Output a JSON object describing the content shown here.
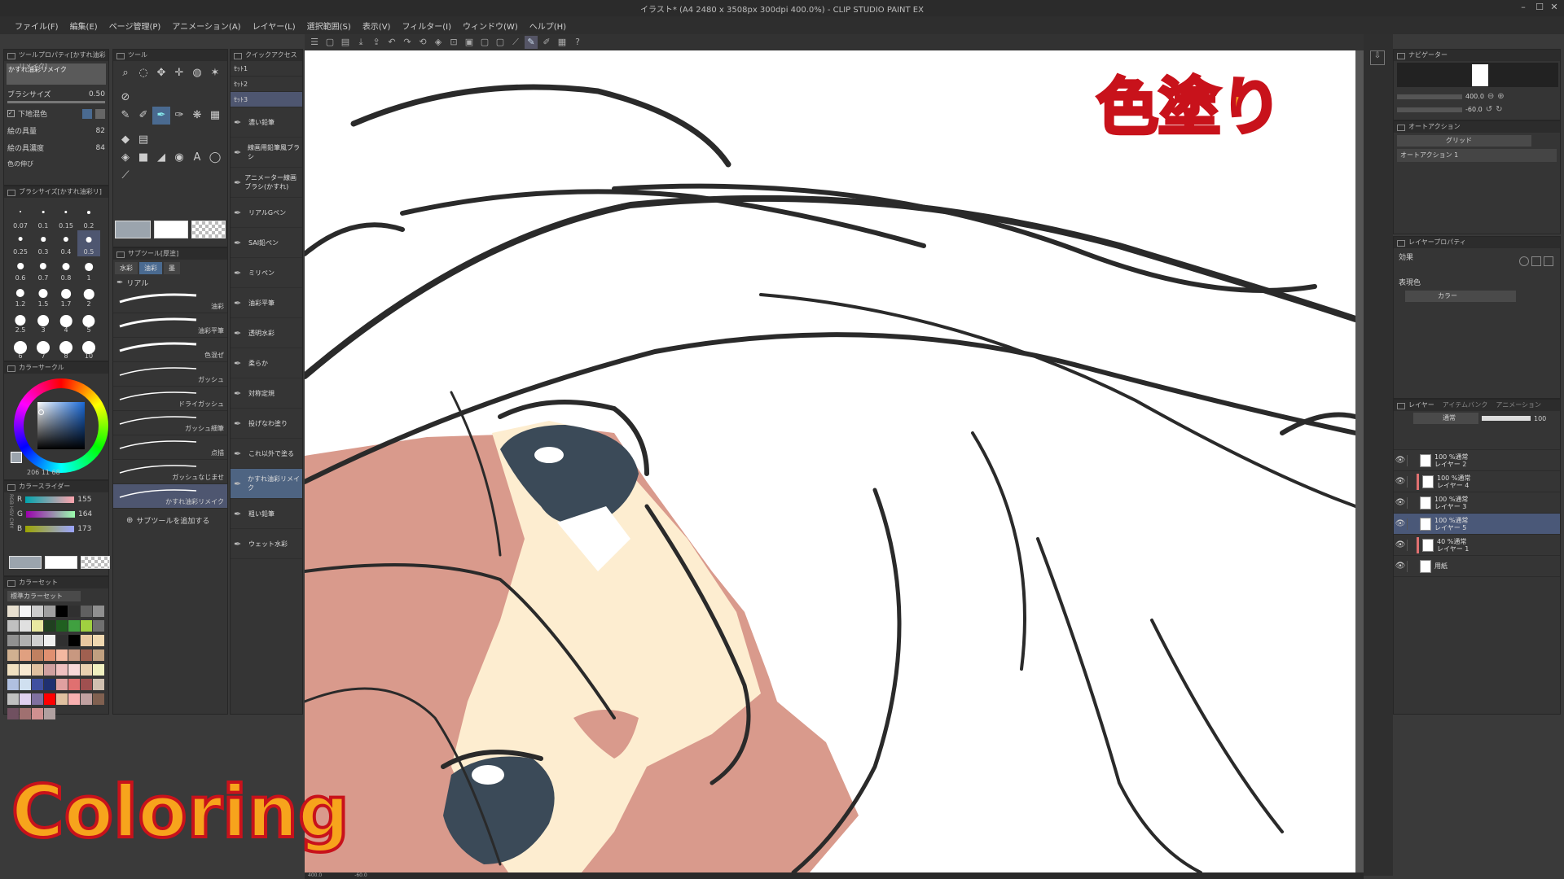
{
  "window": {
    "title": "イラスト* (A4 2480 x 3508px 300dpi 400.0%) - CLIP STUDIO PAINT EX",
    "min": "–",
    "max": "☐",
    "close": "✕"
  },
  "menu": [
    "ファイル(F)",
    "編集(E)",
    "ページ管理(P)",
    "アニメーション(A)",
    "レイヤー(L)",
    "選択範囲(S)",
    "表示(V)",
    "フィルター(I)",
    "ウィンドウ(W)",
    "ヘルプ(H)"
  ],
  "toolbar_icons": [
    "menu-icon",
    "new-icon",
    "open-icon",
    "save-icon",
    "export-icon",
    "undo-icon",
    "redo-icon",
    "transform-icon",
    "fill-icon",
    "crop-icon",
    "sel-a-icon",
    "sel-b-icon",
    "sel-c-icon",
    "pen-a-icon",
    "pen-b-icon",
    "pen-c-icon",
    "ruler-icon",
    "help-icon"
  ],
  "tool_property": {
    "header": "ツールプロパティ[かすれ油彩リメイク]",
    "tool_name": "かすれ油彩リメイク",
    "brush_size_label": "ブラシサイズ",
    "brush_size_value": "0.50",
    "blend_label": "下地混色",
    "paint_amount_label": "絵の具量",
    "paint_amount_value": "82",
    "paint_density_label": "絵の具濃度",
    "paint_density_value": "84",
    "more_label": "色の伸び"
  },
  "brush_size_panel": {
    "header": "ブラシサイズ[かすれ油彩リ]",
    "sizes": [
      "0.07",
      "0.1",
      "0.15",
      "0.2",
      "0.25",
      "0.3",
      "0.4",
      "0.5",
      "0.6",
      "0.7",
      "0.8",
      "1",
      "1.2",
      "1.5",
      "1.7",
      "2",
      "2.5",
      "3",
      "4",
      "5",
      "6",
      "7",
      "8",
      "10"
    ],
    "selected": "0.5"
  },
  "tool_panel": {
    "header": "ツール"
  },
  "quick_access": {
    "header": "クイックアクセス",
    "sets": [
      "ｾｯﾄ1",
      "ｾｯﾄ2",
      "ｾｯﾄ3"
    ],
    "items": [
      "濃い鉛筆",
      "線画用鉛筆風ブラシ",
      "アニメーター線画ブラシ(かすれ)",
      "リアルGペン",
      "SAI鉛ペン",
      "ミリペン",
      "油彩平筆",
      "透明水彩",
      "柔らか",
      "対称定規",
      "投げなわ塗り",
      "これ以外で塗る",
      "かすれ油彩リメイク",
      "粗い鉛筆",
      "ウェット水彩"
    ],
    "selected": 12
  },
  "sub_tool": {
    "header": "サブツール[厚塗]",
    "tabs": [
      "水彩",
      "油彩",
      "墨"
    ],
    "active_tab": 1,
    "group": "リアル",
    "strokes": [
      "油彩",
      "油彩平筆",
      "色混ぜ",
      "ガッシュ",
      "ドライガッシュ",
      "ガッシュ細筆",
      "点描",
      "ガッシュなじませ",
      "かすれ油彩リメイク"
    ],
    "selected": 8,
    "add_label": "サブツールを追加する"
  },
  "color_wheel": {
    "header": "カラーサークル",
    "readout": "206 11 68"
  },
  "color_slider": {
    "header": "カラースライダー",
    "r_label": "R",
    "r": "155",
    "g_label": "G",
    "g": "164",
    "b_label": "B",
    "b": "173",
    "side": "RGB HSV CMY"
  },
  "color_set": {
    "header": "カラーセット",
    "name": "標準カラーセット",
    "colors": [
      "#e8e0d0",
      "#f4f4f4",
      "#cccccc",
      "#a0a0a0",
      "#000000",
      "#303030",
      "#606060",
      "#909090",
      "#c0c0c0",
      "#e0e0e0",
      "#e8e8a0",
      "#204020",
      "#206020",
      "#40a040",
      "#a0d040",
      "#707070",
      "#909090",
      "#b0b0b0",
      "#d0d0d0",
      "#f0f0f0",
      "#303030",
      "#000000",
      "#e8c8a0",
      "#f0d8b0",
      "#d0b090",
      "#e0a080",
      "#c08060",
      "#e09070",
      "#f4b8a0",
      "#c89880",
      "#a06050",
      "#c0a080",
      "#f0e0c0",
      "#f8e8d0",
      "#e0c0a0",
      "#d0a0a0",
      "#f0c0c0",
      "#f8d8d8",
      "#e8d0b0",
      "#f0f0c0",
      "#b0c0e0",
      "#d0e0f0",
      "#4050a0",
      "#203070",
      "#e0a0a0",
      "#e07070",
      "#a05050",
      "#d0c0b0",
      "#c0c0c0",
      "#e0d0f0",
      "#8070a0",
      "#ff0000",
      "#e0c0a0",
      "#f8b0b0",
      "#c0a0a0",
      "#806050",
      "#705060",
      "#a07070",
      "#d09090",
      "#b0a0a0"
    ]
  },
  "navigator": {
    "header": "ナビゲーター",
    "zoom": "400.0",
    "angle": "-60.0"
  },
  "auto_action": {
    "header": "オートアクション",
    "set": "グリッド",
    "item": "オートアクション 1"
  },
  "layer_property": {
    "header": "レイヤープロパティ",
    "effect_label": "効果",
    "color_label": "表現色",
    "color_value": "カラー"
  },
  "layer_panel": {
    "header": "レイヤー",
    "tabs": [
      "アイテムバンク",
      "アニメーション"
    ],
    "blend": "通常",
    "opacity": "100",
    "layers": [
      {
        "line1": "100 %通常",
        "line2": "レイヤー 2",
        "selected": false,
        "color": false
      },
      {
        "line1": "100 %通常",
        "line2": "レイヤー 4",
        "selected": false,
        "color": true
      },
      {
        "line1": "100 %通常",
        "line2": "レイヤー 3",
        "selected": false,
        "color": false
      },
      {
        "line1": "100 %通常",
        "line2": "レイヤー 5",
        "selected": true,
        "color": false
      },
      {
        "line1": "40 %通常",
        "line2": "レイヤー 1",
        "selected": false,
        "color": true
      },
      {
        "line1": "",
        "line2": "用紙",
        "selected": false,
        "color": false
      }
    ]
  },
  "overlay": {
    "title_jp": "色塗り",
    "title_en": "Coloring"
  },
  "status": {
    "zoom": "400.0",
    "angle": "-60.0"
  },
  "colors": {
    "accent_orange": "#f7a41c",
    "accent_red": "#c8121b",
    "skin": "#fdedd0",
    "shadow": "#d99a8c",
    "eye": "#3b4a58"
  }
}
